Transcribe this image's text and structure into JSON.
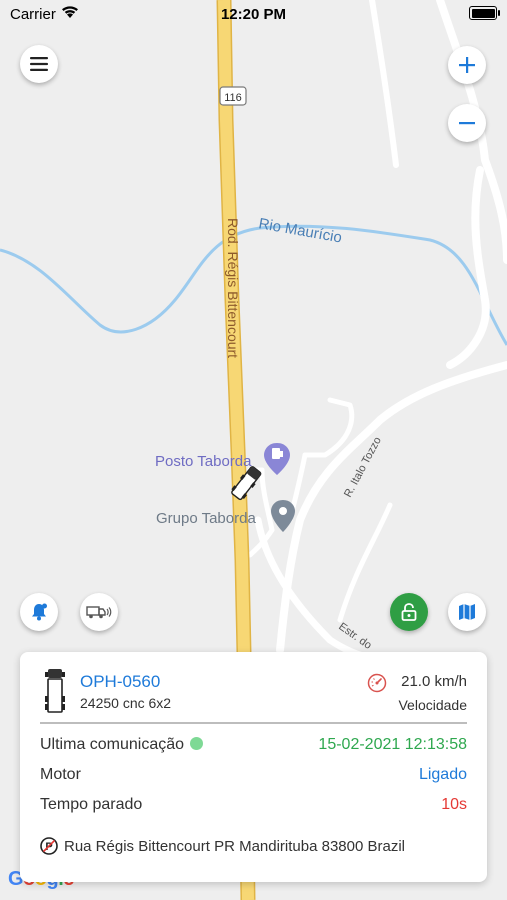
{
  "status_bar": {
    "carrier": "Carrier",
    "time": "12:20 PM"
  },
  "map": {
    "road_shield": "116",
    "road_name": "Rod. Régis Bittencourt",
    "river_name": "Rio Maurício",
    "street_italo": "R. Italo Tozzo",
    "street_estr": "Estr. do",
    "poi_posto": "Posto Taborda",
    "poi_grupo": "Grupo Taborda",
    "google_logo": "Google",
    "colors": {
      "land": "#eeeeee",
      "highway": "#f7d774",
      "highway_border": "#e0b445",
      "water": "#9ccbee",
      "road": "#ffffff",
      "poi_purple": "#8a86d6",
      "poi_gray": "#7d8a99"
    }
  },
  "controls": {
    "menu_icon": "hamburger-icon",
    "zoom_in_icon": "plus-icon",
    "zoom_out_icon": "minus-icon",
    "alert_icon": "bell-icon",
    "vehicle_icon": "truck-signal-icon",
    "lock_icon": "lock-icon",
    "map_icon": "map-icon"
  },
  "vehicle": {
    "plate": "OPH-0560",
    "description": "24250 cnc 6x2",
    "speed": "21.0 km/h",
    "speed_label": "Velocidade",
    "rows": {
      "last_comm_label": "Ultima comunicação",
      "last_comm_value": "15-02-2021 12:13:58",
      "motor_label": "Motor",
      "motor_value": "Ligado",
      "stopped_label": "Tempo parado",
      "stopped_value": "10s"
    },
    "address": "Rua Régis Bittencourt PR Mandirituba 83800 Brazil",
    "colors": {
      "plate": "#1e7ad9",
      "last_comm": "#2fa84f",
      "motor": "#1e7ad9",
      "stopped": "#e53935",
      "status_dot": "#7ed995"
    }
  }
}
